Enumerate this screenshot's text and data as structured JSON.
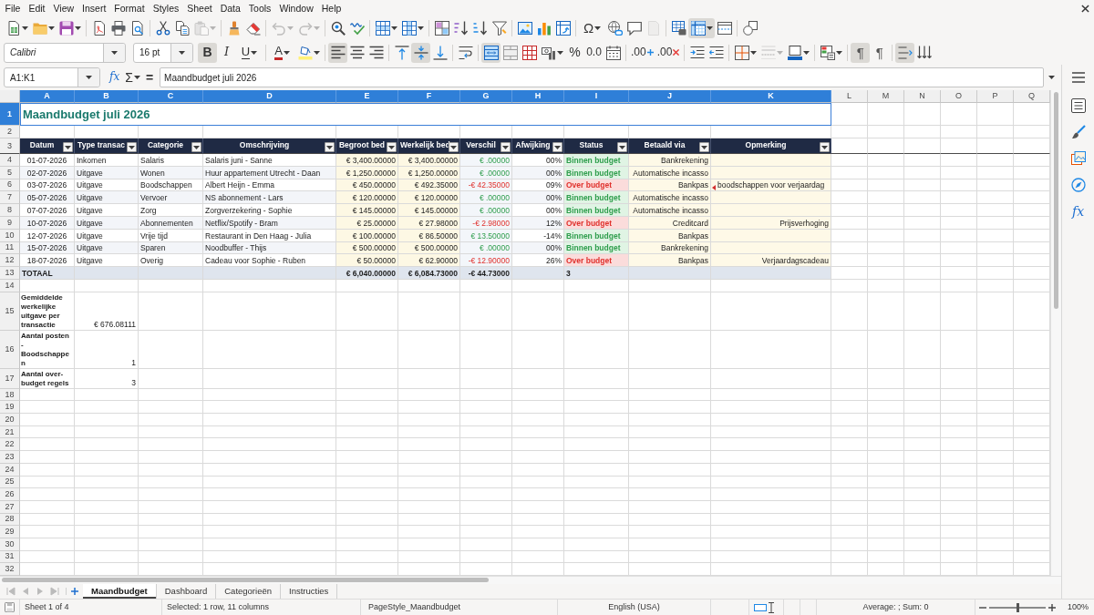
{
  "menu_bar": [
    "File",
    "Edit",
    "View",
    "Insert",
    "Format",
    "Styles",
    "Sheet",
    "Data",
    "Tools",
    "Window",
    "Help"
  ],
  "toolbar_standard": [
    [
      {
        "kind": "new",
        "dropdown": true,
        "pressed": false,
        "disabled": false
      },
      {
        "kind": "open",
        "dropdown": true,
        "pressed": false,
        "disabled": false
      },
      {
        "kind": "save",
        "dropdown": true,
        "pressed": false,
        "disabled": false
      }
    ],
    [
      {
        "kind": "pdf",
        "dropdown": false,
        "pressed": false,
        "disabled": false
      },
      {
        "kind": "print",
        "dropdown": false,
        "pressed": false,
        "disabled": false
      },
      {
        "kind": "preview",
        "dropdown": false,
        "pressed": false,
        "disabled": false
      }
    ],
    [
      {
        "kind": "cut",
        "dropdown": false,
        "pressed": false,
        "disabled": false
      },
      {
        "kind": "copy",
        "dropdown": false,
        "pressed": false,
        "disabled": false
      },
      {
        "kind": "paste",
        "dropdown": true,
        "pressed": false,
        "disabled": true
      }
    ],
    [
      {
        "kind": "clone",
        "dropdown": false,
        "pressed": false,
        "disabled": false
      },
      {
        "kind": "clear",
        "dropdown": false,
        "pressed": false,
        "disabled": false
      }
    ],
    [
      {
        "kind": "undo",
        "dropdown": true,
        "pressed": false,
        "disabled": true
      },
      {
        "kind": "redo",
        "dropdown": true,
        "pressed": false,
        "disabled": true
      }
    ],
    [
      {
        "kind": "find",
        "dropdown": false,
        "pressed": false,
        "disabled": false
      },
      {
        "kind": "spelling",
        "dropdown": false,
        "pressed": false,
        "disabled": false
      }
    ],
    [
      {
        "kind": "rows",
        "dropdown": true,
        "pressed": false,
        "disabled": false
      },
      {
        "kind": "columns",
        "dropdown": true,
        "pressed": false,
        "disabled": false
      }
    ],
    [
      {
        "kind": "sort",
        "dropdown": false,
        "pressed": false,
        "disabled": false
      },
      {
        "kind": "sortup",
        "dropdown": false,
        "pressed": false,
        "disabled": false
      },
      {
        "kind": "sortdown",
        "dropdown": false,
        "pressed": false,
        "disabled": false
      },
      {
        "kind": "filter",
        "dropdown": false,
        "pressed": false,
        "disabled": false
      }
    ],
    [
      {
        "kind": "image",
        "dropdown": false,
        "pressed": false,
        "disabled": false
      },
      {
        "kind": "chart",
        "dropdown": false,
        "pressed": false,
        "disabled": false
      },
      {
        "kind": "pivot",
        "dropdown": false,
        "pressed": false,
        "disabled": false
      }
    ],
    [
      {
        "kind": "special",
        "label": "Ω",
        "dropdown": true,
        "pressed": false,
        "disabled": false
      },
      {
        "kind": "link",
        "dropdown": false,
        "pressed": false,
        "disabled": false
      },
      {
        "kind": "comment",
        "dropdown": false,
        "pressed": false,
        "disabled": false
      },
      {
        "kind": "headerfooter",
        "dropdown": false,
        "pressed": false,
        "disabled": true
      }
    ],
    [
      {
        "kind": "printarea",
        "dropdown": false,
        "pressed": false,
        "disabled": false
      },
      {
        "kind": "freeze",
        "dropdown": true,
        "pressed": true,
        "disabled": false
      },
      {
        "kind": "split",
        "dropdown": false,
        "pressed": false,
        "disabled": false
      }
    ],
    [
      {
        "kind": "shapes",
        "dropdown": false,
        "pressed": false,
        "disabled": false
      }
    ]
  ],
  "toolbar_formatting": {
    "font_name": "Calibri",
    "font_size": "16 pt",
    "buttons": [
      [
        {
          "kind": "bold",
          "label": "B",
          "dropdown": false,
          "pressed": true,
          "disabled": false
        },
        {
          "kind": "italic",
          "label": "I",
          "dropdown": false,
          "pressed": false,
          "disabled": false
        },
        {
          "kind": "underline",
          "label": "U",
          "dropdown": true,
          "pressed": false,
          "disabled": false
        }
      ],
      [
        {
          "kind": "fontcolor",
          "label": "A",
          "dropdown": true,
          "pressed": false,
          "disabled": false
        },
        {
          "kind": "highlight",
          "dropdown": true,
          "pressed": false,
          "disabled": false
        }
      ],
      [
        {
          "kind": "alignleft",
          "dropdown": false,
          "pressed": true,
          "disabled": false
        },
        {
          "kind": "aligncenter",
          "dropdown": false,
          "pressed": false,
          "disabled": false
        },
        {
          "kind": "alignright",
          "dropdown": false,
          "pressed": false,
          "disabled": false
        }
      ],
      [
        {
          "kind": "aligntop",
          "dropdown": false,
          "pressed": false,
          "disabled": false
        },
        {
          "kind": "alignmiddle",
          "dropdown": false,
          "pressed": true,
          "disabled": false
        },
        {
          "kind": "alignbottom",
          "dropdown": false,
          "pressed": false,
          "disabled": false
        }
      ],
      [
        {
          "kind": "wrap",
          "dropdown": false,
          "pressed": false,
          "disabled": false
        }
      ],
      [
        {
          "kind": "mergecenter",
          "dropdown": false,
          "pressed": true,
          "disabled": false
        },
        {
          "kind": "merge",
          "dropdown": false,
          "pressed": false,
          "disabled": false
        },
        {
          "kind": "unmerge",
          "dropdown": false,
          "pressed": false,
          "disabled": false
        },
        {
          "kind": "currency",
          "dropdown": true,
          "pressed": false,
          "disabled": false
        },
        {
          "kind": "percent",
          "label": "%",
          "dropdown": false,
          "pressed": false,
          "disabled": false
        },
        {
          "kind": "number",
          "label": "0.0",
          "dropdown": false,
          "pressed": false,
          "disabled": false
        },
        {
          "kind": "date",
          "dropdown": false,
          "pressed": false,
          "disabled": false
        }
      ],
      [
        {
          "kind": "adddecimal",
          "label": ".00",
          "dropdown": false,
          "pressed": false,
          "disabled": false
        },
        {
          "kind": "deldecimal",
          "label": ".00",
          "dropdown": false,
          "pressed": false,
          "disabled": false
        }
      ],
      [
        {
          "kind": "indent",
          "dropdown": false,
          "pressed": false,
          "disabled": false
        },
        {
          "kind": "outdent",
          "dropdown": false,
          "pressed": false,
          "disabled": false
        }
      ],
      [
        {
          "kind": "borders",
          "dropdown": true,
          "pressed": false,
          "disabled": false
        },
        {
          "kind": "borderstyle",
          "dropdown": true,
          "pressed": false,
          "disabled": true
        },
        {
          "kind": "bordercolor",
          "dropdown": true,
          "pressed": false,
          "disabled": false
        }
      ],
      [
        {
          "kind": "conditional",
          "dropdown": true,
          "pressed": false,
          "disabled": false
        }
      ],
      [
        {
          "kind": "ltr",
          "label": "¶",
          "dropdown": false,
          "pressed": true,
          "disabled": false
        },
        {
          "kind": "rtl",
          "label": "¶",
          "dropdown": false,
          "pressed": false,
          "disabled": false
        }
      ],
      [
        {
          "kind": "textdir",
          "dropdown": false,
          "pressed": true,
          "disabled": false
        },
        {
          "kind": "verticaltext",
          "dropdown": false,
          "pressed": false,
          "disabled": false
        }
      ]
    ]
  },
  "formula_bar": {
    "name_box": "A1:K1",
    "buttons": [
      {
        "kind": "wizard",
        "label": "fx",
        "dropdown": false
      },
      {
        "kind": "sum",
        "label": "Σ",
        "dropdown": true
      },
      {
        "kind": "formula",
        "label": "=",
        "dropdown": false
      }
    ],
    "content": "Maandbudget juli 2026"
  },
  "sidebar": [
    {
      "kind": "properties"
    },
    {
      "kind": "styles"
    },
    {
      "kind": "gallery"
    },
    {
      "kind": "navigator"
    },
    {
      "kind": "functions",
      "label": "fx"
    }
  ],
  "sheet": {
    "column_letters": [
      {
        "label": "A",
        "selected": true
      },
      {
        "label": "B",
        "selected": true
      },
      {
        "label": "C",
        "selected": true
      },
      {
        "label": "D",
        "selected": true
      },
      {
        "label": "E",
        "selected": true
      },
      {
        "label": "F",
        "selected": true
      },
      {
        "label": "G",
        "selected": true
      },
      {
        "label": "H",
        "selected": true
      },
      {
        "label": "I",
        "selected": true
      },
      {
        "label": "J",
        "selected": true
      },
      {
        "label": "K",
        "selected": true
      },
      {
        "label": "L",
        "selected": false
      },
      {
        "label": "M",
        "selected": false
      },
      {
        "label": "N",
        "selected": false
      },
      {
        "label": "O",
        "selected": false
      },
      {
        "label": "P",
        "selected": false
      },
      {
        "label": "Q",
        "selected": false
      }
    ],
    "row_numbers": [
      {
        "label": "1",
        "selected": true
      },
      {
        "label": "2",
        "selected": false
      },
      {
        "label": "3",
        "selected": false
      },
      {
        "label": "4",
        "selected": false
      },
      {
        "label": "5",
        "selected": false
      },
      {
        "label": "6",
        "selected": false
      },
      {
        "label": "7",
        "selected": false
      },
      {
        "label": "8",
        "selected": false
      },
      {
        "label": "9",
        "selected": false
      },
      {
        "label": "10",
        "selected": false
      },
      {
        "label": "11",
        "selected": false
      },
      {
        "label": "12",
        "selected": false
      },
      {
        "label": "13",
        "selected": false
      },
      {
        "label": "14",
        "selected": false
      },
      {
        "label": "15",
        "selected": false
      },
      {
        "label": "16",
        "selected": false
      },
      {
        "label": "17",
        "selected": false
      },
      {
        "label": "18",
        "selected": false
      },
      {
        "label": "19",
        "selected": false
      },
      {
        "label": "20",
        "selected": false
      },
      {
        "label": "21",
        "selected": false
      },
      {
        "label": "22",
        "selected": false
      },
      {
        "label": "23",
        "selected": false
      },
      {
        "label": "24",
        "selected": false
      },
      {
        "label": "25",
        "selected": false
      },
      {
        "label": "26",
        "selected": false
      },
      {
        "label": "27",
        "selected": false
      },
      {
        "label": "28",
        "selected": false
      },
      {
        "label": "29",
        "selected": false
      },
      {
        "label": "30",
        "selected": false
      },
      {
        "label": "31",
        "selected": false
      },
      {
        "label": "32",
        "selected": false
      }
    ],
    "title": {
      "text": "Maandbudget juli 2026",
      "selected": true
    },
    "table": {
      "header": [
        "Datum",
        "Type transac",
        "Categorie",
        "Omschrijving",
        "Begroot bed",
        "Werkelijk bed",
        "Verschil",
        "Afwijking",
        "Status",
        "Betaald via",
        "Opmerking"
      ],
      "rows": [
        {
          "over_budget": false,
          "clipped": false,
          "cells": {
            "A": "01-07-2026",
            "B": "Inkomen",
            "C": "Salaris",
            "D": "Salaris juni - Sanne",
            "E": "€ 3,400.00000",
            "F": "€ 3,400.00000",
            "G": "€ .00000",
            "H": "00%",
            "I": "Binnen budget",
            "J": "Bankrekening"
          }
        },
        {
          "over_budget": false,
          "clipped": false,
          "cells": {
            "A": "02-07-2026",
            "B": "Uitgave",
            "C": "Wonen",
            "D": "Huur appartement Utrecht - Daan",
            "E": "€ 1,250.00000",
            "F": "€ 1,250.00000",
            "G": "€ .00000",
            "H": "00%",
            "I": "Binnen budget",
            "J": "Automatische incasso"
          }
        },
        {
          "over_budget": true,
          "clipped": true,
          "cells": {
            "A": "03-07-2026",
            "B": "Uitgave",
            "C": "Boodschappen",
            "D": "Albert Heijn - Emma",
            "E": "€ 450.00000",
            "F": "€ 492.35000",
            "G": "-€ 42.35000",
            "H": "09%",
            "I": "Over budget",
            "J": "Bankpas",
            "K": "boodschappen voor verjaardag"
          }
        },
        {
          "over_budget": false,
          "clipped": false,
          "cells": {
            "A": "05-07-2026",
            "B": "Uitgave",
            "C": "Vervoer",
            "D": "NS abonnement - Lars",
            "E": "€ 120.00000",
            "F": "€ 120.00000",
            "G": "€ .00000",
            "H": "00%",
            "I": "Binnen budget",
            "J": "Automatische incasso"
          }
        },
        {
          "over_budget": false,
          "clipped": false,
          "cells": {
            "A": "07-07-2026",
            "B": "Uitgave",
            "C": "Zorg",
            "D": "Zorgverzekering - Sophie",
            "E": "€ 145.00000",
            "F": "€ 145.00000",
            "G": "€ .00000",
            "H": "00%",
            "I": "Binnen budget",
            "J": "Automatische incasso"
          }
        },
        {
          "over_budget": true,
          "clipped": false,
          "cells": {
            "A": "10-07-2026",
            "B": "Uitgave",
            "C": "Abonnementen",
            "D": "Netflix/Spotify - Bram",
            "E": "€ 25.00000",
            "F": "€ 27.98000",
            "G": "-€ 2.98000",
            "H": "12%",
            "I": "Over budget",
            "J": "Creditcard",
            "K": "Prijsverhoging"
          }
        },
        {
          "over_budget": false,
          "clipped": false,
          "cells": {
            "A": "12-07-2026",
            "B": "Uitgave",
            "C": "Vrije tijd",
            "D": "Restaurant in Den Haag - Julia",
            "E": "€ 100.00000",
            "F": "€ 86.50000",
            "G": "€ 13.50000",
            "H": "-14%",
            "I": "Binnen budget",
            "J": "Bankpas"
          }
        },
        {
          "over_budget": false,
          "clipped": false,
          "cells": {
            "A": "15-07-2026",
            "B": "Uitgave",
            "C": "Sparen",
            "D": "Noodbuffer - Thijs",
            "E": "€ 500.00000",
            "F": "€ 500.00000",
            "G": "€ .00000",
            "H": "00%",
            "I": "Binnen budget",
            "J": "Bankrekening"
          }
        },
        {
          "over_budget": true,
          "clipped": false,
          "cells": {
            "A": "18-07-2026",
            "B": "Uitgave",
            "C": "Overig",
            "D": "Cadeau voor Sophie - Ruben",
            "E": "€ 50.00000",
            "F": "€ 62.90000",
            "G": "-€ 12.90000",
            "H": "26%",
            "I": "Over budget",
            "J": "Bankpas",
            "K": "Verjaardagscadeau"
          }
        }
      ],
      "total": {
        "A": "TOTAAL",
        "E": "€ 6,040.00000",
        "F": "€ 6,084.73000",
        "G": "-€ 44.73000",
        "I": "3"
      }
    },
    "summary": [
      {
        "label": "Gemiddelde werkelijke uitgave per transactie",
        "value": "€ 676.08111"
      },
      {
        "label": "Aantal posten - Boodschappen",
        "value": "1"
      },
      {
        "label": "Aantal over-budget regels",
        "value": "3"
      }
    ]
  },
  "sheet_tabs": [
    {
      "label": "Maandbudget",
      "selected": true
    },
    {
      "label": "Dashboard",
      "selected": false
    },
    {
      "label": "Categorieën",
      "selected": false
    },
    {
      "label": "Instructies",
      "selected": false
    }
  ],
  "status_bar": {
    "sheet": "Sheet 1 of 4",
    "selection": "Selected: 1 row, 11 columns",
    "page_style": "PageStyle_Maandbudget",
    "language": "English (USA)",
    "statistics": "Average: ; Sum: 0",
    "zoom": {
      "level": 0.5,
      "label": "100%"
    }
  }
}
